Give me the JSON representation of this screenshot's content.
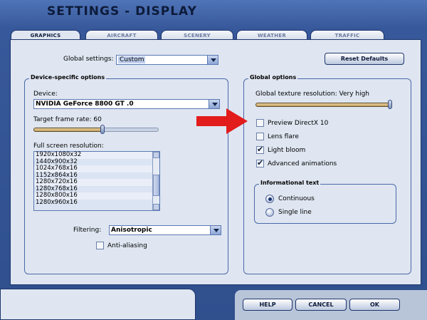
{
  "window": {
    "title": "SETTINGS - DISPLAY"
  },
  "tabs": [
    {
      "label": "GRAPHICS",
      "active": true
    },
    {
      "label": "AIRCRAFT",
      "active": false
    },
    {
      "label": "SCENERY",
      "active": false
    },
    {
      "label": "WEATHER",
      "active": false
    },
    {
      "label": "TRAFFIC",
      "active": false
    }
  ],
  "global_settings": {
    "label": "Global settings:",
    "value": "Custom"
  },
  "reset_defaults_label": "Reset Defaults",
  "device_options": {
    "title": "Device-specific options",
    "device_label": "Device:",
    "device_value": "NVIDIA GeForce 8800 GT .0",
    "frame_rate_label": "Target frame rate: 60",
    "frame_rate_value": 60,
    "resolution_label": "Full screen resolution:",
    "resolutions": [
      "1920x1080x32",
      "1440x900x32",
      "1024x768x16",
      "1152x864x16",
      "1280x720x16",
      "1280x768x16",
      "1280x800x16",
      "1280x960x16"
    ],
    "filtering_label": "Filtering:",
    "filtering_value": "Anisotropic",
    "antialiasing_label": "Anti-aliasing",
    "antialiasing_checked": false
  },
  "global_options": {
    "title": "Global options",
    "texture_label": "Global texture resolution: Very high",
    "checkboxes": [
      {
        "label": "Preview DirectX 10",
        "checked": false
      },
      {
        "label": "Lens flare",
        "checked": false
      },
      {
        "label": "Light bloom",
        "checked": true
      },
      {
        "label": "Advanced animations",
        "checked": true
      }
    ],
    "informational_text": {
      "title": "Informational text",
      "options": [
        {
          "label": "Continuous",
          "selected": true
        },
        {
          "label": "Single line",
          "selected": false
        }
      ]
    }
  },
  "buttons": {
    "help": "HELP",
    "cancel": "CANCEL",
    "ok": "OK"
  },
  "colors": {
    "accent": "#2e4f8f",
    "annotation_arrow": "#e21b1b"
  }
}
